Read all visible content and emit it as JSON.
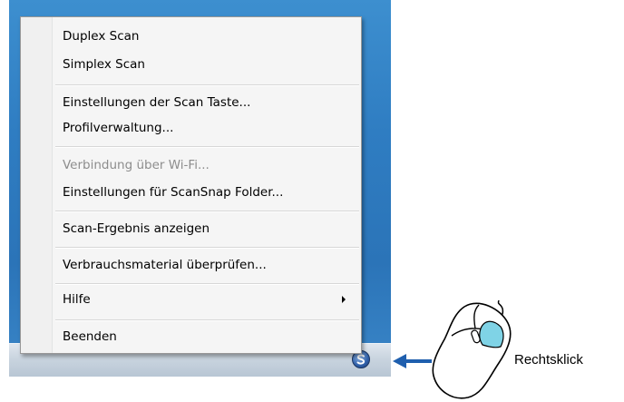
{
  "menu": {
    "items": [
      {
        "label": "Duplex Scan"
      },
      {
        "label": "Simplex Scan"
      },
      {
        "label": "Einstellungen der Scan Taste..."
      },
      {
        "label": "Profilverwaltung..."
      },
      {
        "label": "Verbindung über Wi-Fi...",
        "disabled": true
      },
      {
        "label": "Einstellungen für ScanSnap Folder..."
      },
      {
        "label": "Scan-Ergebnis anzeigen"
      },
      {
        "label": "Verbrauchsmaterial überprüfen..."
      },
      {
        "label": "Hilfe",
        "has_submenu": true
      },
      {
        "label": "Beenden"
      }
    ]
  },
  "taskbar": {
    "tray_icon": "scansnap-manager-icon"
  },
  "callout": {
    "label": "Rechtsklick",
    "icon": "mouse-right-click-icon",
    "arrow": "arrow-left-icon",
    "accent_color": "#1f5fae",
    "highlight_color": "#7fd3e6"
  }
}
